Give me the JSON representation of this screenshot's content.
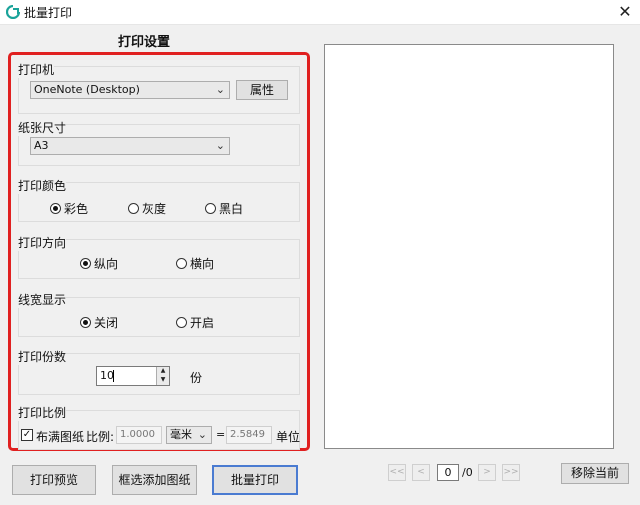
{
  "window": {
    "title": "批量打印",
    "close_glyph": "✕",
    "icon": "printer-app-icon"
  },
  "settings_title": "打印设置",
  "printer": {
    "label": "打印机",
    "selected": "OneNote (Desktop)",
    "properties_button": "属性"
  },
  "paper_size": {
    "label": "纸张尺寸",
    "selected": "A3"
  },
  "color": {
    "label": "打印颜色",
    "options": [
      "彩色",
      "灰度",
      "黑白"
    ],
    "selected": "彩色"
  },
  "orientation": {
    "label": "打印方向",
    "options": [
      "纵向",
      "横向"
    ],
    "selected": "纵向"
  },
  "line_width": {
    "label": "线宽显示",
    "options": [
      "关闭",
      "开启"
    ],
    "selected": "关闭"
  },
  "copies": {
    "label": "打印份数",
    "value": "10",
    "unit": "份"
  },
  "scale": {
    "label": "打印比例",
    "fit_checkbox_label": "布满图纸",
    "fit_checked": true,
    "ratio_label": "比例:",
    "ratio_value": "1.0000",
    "unit_selected": "毫米",
    "equals": "=",
    "unit_value": "2.5849",
    "unit_label": "单位"
  },
  "buttons": {
    "preview": "打印预览",
    "add_drawings": "框选添加图纸",
    "batch_print": "批量打印",
    "remove_current": "移除当前"
  },
  "pager": {
    "first": "<<",
    "prev": "<",
    "current": "0",
    "total": "/0",
    "next": ">",
    "last": ">>"
  }
}
